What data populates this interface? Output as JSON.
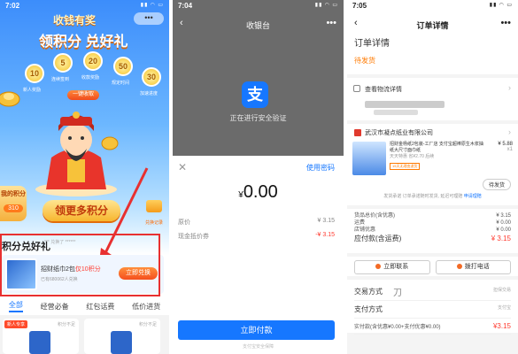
{
  "panel1": {
    "status_time": "7:02",
    "brand_line1": "收钱有奖",
    "brand_line2": "领积分 兑好礼",
    "capsule": "•••",
    "coins": [
      {
        "label": "新人奖励",
        "value": "10"
      },
      {
        "label": "连续签到",
        "value": "5"
      },
      {
        "label": "收款奖励",
        "value": "20"
      },
      {
        "label": "规定时间",
        "value": "50"
      },
      {
        "label": "加速进度",
        "value": "30"
      }
    ],
    "claim_button": "一键收取",
    "points_label": "我的积分",
    "points_value": "310",
    "redeem_more_button": "领更多积分",
    "redeem_record": "兑换记录",
    "section_title": "积分兑好礼",
    "ticker": "*** 兑换了 ******",
    "product": {
      "name_prefix": "招财纸巾2包",
      "name_highlight": "仅10积分",
      "sub": "已有680062人兑换",
      "button": "立即兑换"
    },
    "tabs": [
      "全部",
      "经营必备",
      "红包话费",
      "低价进货"
    ],
    "cards": [
      {
        "tag": "新人专享",
        "hint": "积分不足"
      },
      {
        "tag": "",
        "hint": "积分不足"
      }
    ]
  },
  "panel2": {
    "status_time": "7:04",
    "title": "收银台",
    "more": "•••",
    "verify_text": "正在进行安全验证",
    "alipay_glyph": "支",
    "use_password": "使用密码",
    "currency": "¥",
    "amount": "0.00",
    "rows": [
      {
        "label": "原价",
        "value": "¥ 3.15"
      },
      {
        "label": "现金抵价券",
        "value": "-¥ 3.15"
      }
    ],
    "pay_button": "立即付款",
    "pay_note": "支付宝安全保障"
  },
  "panel3": {
    "status_time": "7:05",
    "title": "订单详情",
    "more": "•••",
    "order_status_title": "订单详情",
    "order_status": "待发货",
    "logistics_label": "查看物流详情",
    "shop_name": "武汉市凝点纸业有限公司",
    "product_name": "招财金杨纸2包装-工厂店 支付宝超棒原生木浆抽纸大尺寸面巾纸",
    "product_sub": "天天特惠 省¥2.70 后续",
    "product_price": "¥ 5.88",
    "product_qty": "x1",
    "product_tag": "15天无理由退货",
    "refund_button": "待发货",
    "ship_note": "发货承诺 订单承诺随时发货, 延迟可理赔",
    "ship_link": "申请理赔",
    "money_rows": [
      {
        "label": "货品总价(含优惠)",
        "value": "¥ 3.15"
      },
      {
        "label": "运费",
        "value": "¥ 0.00"
      },
      {
        "label": "店铺优惠",
        "value": "¥ 0.00"
      }
    ],
    "paid_label": "应付款(含运费)",
    "paid_value": "¥ 3.15",
    "contact_button": "立即联系",
    "call_button": "拨打电话",
    "trade_title": "交易方式",
    "trade_value": "担保交易",
    "pay_method_title": "支付方式",
    "pay_method_value": "支付宝",
    "actual_label": "实付款(含优惠¥0.00+支付优惠¥0.00)",
    "actual_value": "¥3.15",
    "glyph": "刀"
  }
}
